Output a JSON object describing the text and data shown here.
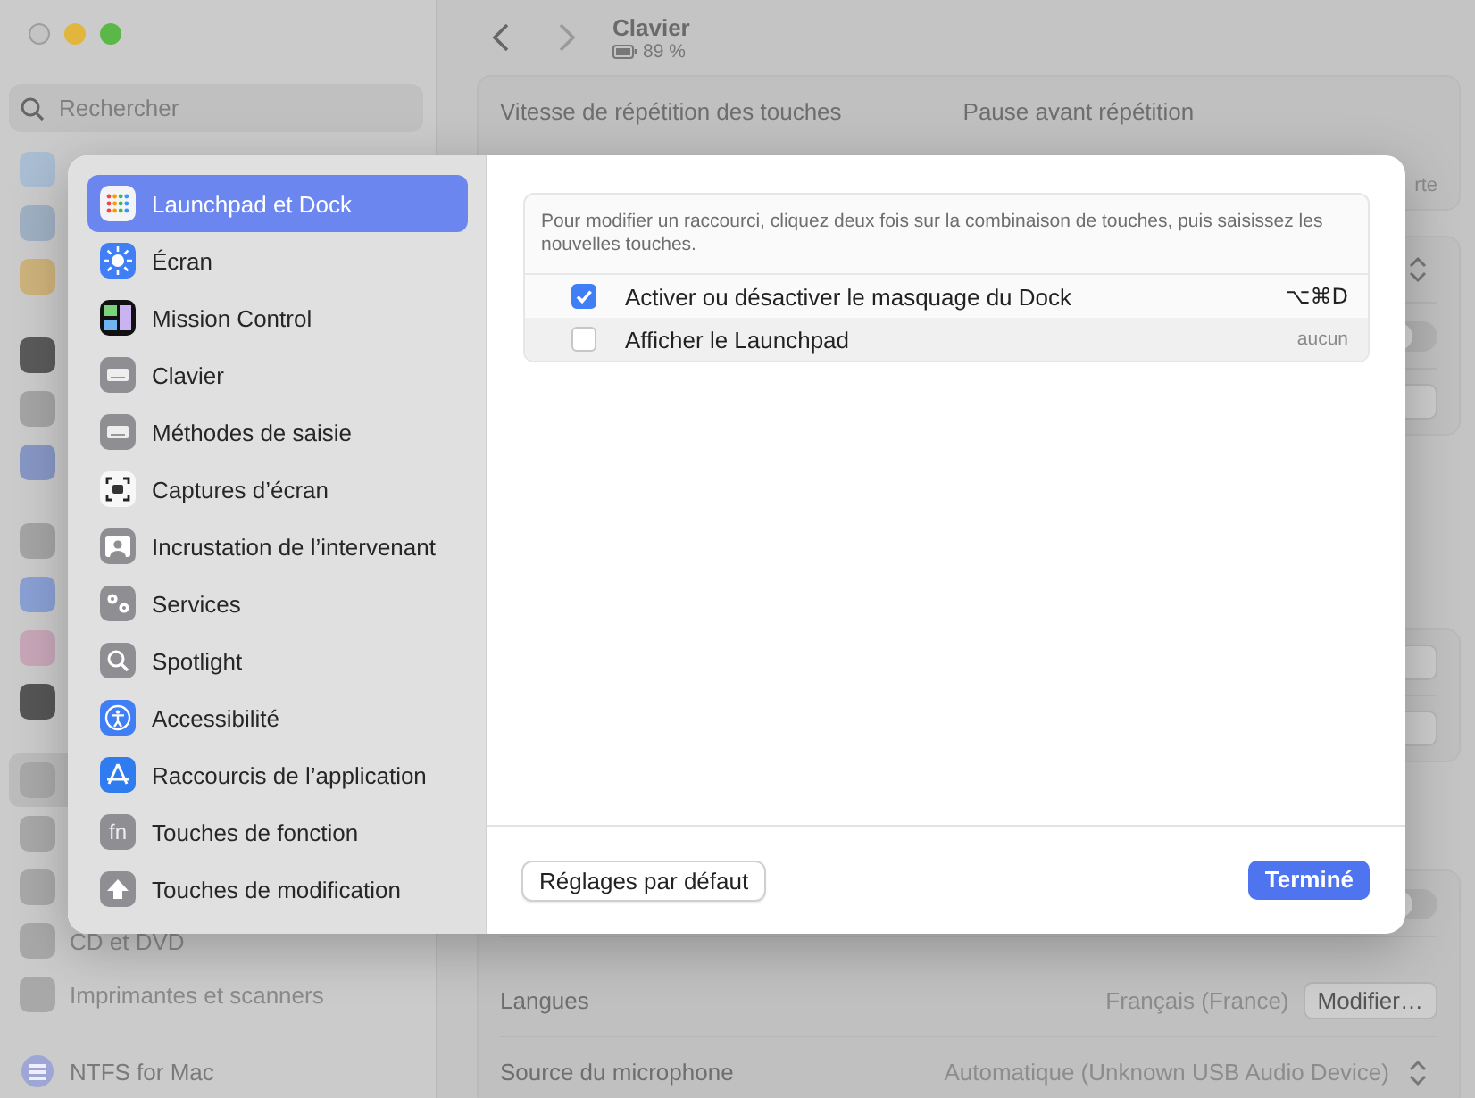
{
  "window": {
    "title": "Clavier",
    "battery": "89 %"
  },
  "sidebar": {
    "search": {
      "placeholder": "Rechercher"
    },
    "items": [
      {
        "selected": false
      },
      {
        "selected": false
      },
      {
        "selected": false
      },
      {
        "selected": false
      },
      {
        "selected": false
      },
      {
        "selected": false
      },
      {
        "selected": false
      },
      {
        "selected": false
      },
      {
        "selected": false
      },
      {
        "selected": false
      },
      {
        "selected": true
      },
      {
        "selected": false
      },
      {
        "selected": false
      },
      {
        "selected": false,
        "label": "CD et DVD"
      },
      {
        "selected": false,
        "label": "Imprimantes et scanners"
      }
    ],
    "footer": "NTFS for Mac"
  },
  "settings": {
    "repeat_labels": [
      "Vitesse de répétition des touches",
      "Pause avant répétition"
    ],
    "slider_end_label": "rte",
    "groups": [
      {
        "rows": [
          {
            "kind": "stepper"
          },
          {
            "kind": "toggle",
            "on": false
          },
          {
            "kind": "button"
          }
        ]
      },
      {
        "rows": [
          {
            "kind": "button"
          },
          {
            "kind": "button"
          }
        ]
      },
      {
        "rows": [
          {
            "kind": "toggle",
            "on": false
          },
          {
            "kind": "labeled-button",
            "label": "Langues",
            "value": "Français (France)",
            "button": "Modifier…"
          },
          {
            "kind": "labeled-stepper",
            "label": "Source du microphone",
            "value": "Automatique (Unknown USB Audio Device)"
          }
        ]
      }
    ]
  },
  "sheet": {
    "categories": [
      {
        "label": "Launchpad et Dock",
        "selected": true
      },
      {
        "label": "Écran",
        "selected": false
      },
      {
        "label": "Mission Control",
        "selected": false
      },
      {
        "label": "Clavier",
        "selected": false
      },
      {
        "label": "Méthodes de saisie",
        "selected": false
      },
      {
        "label": "Captures d’écran",
        "selected": false
      },
      {
        "label": "Incrustation de l’intervenant",
        "selected": false
      },
      {
        "label": "Services",
        "selected": false
      },
      {
        "label": "Spotlight",
        "selected": false
      },
      {
        "label": "Accessibilité",
        "selected": false
      },
      {
        "label": "Raccourcis de l’application",
        "selected": false
      },
      {
        "label": "Touches de fonction",
        "selected": false,
        "icon_text": "fn"
      },
      {
        "label": "Touches de modification",
        "selected": false
      }
    ],
    "info": "Pour modifier un raccourci, cliquez deux fois sur la combinaison de touches, puis saisissez les nouvelles touches.",
    "shortcuts": [
      {
        "label": "Activer ou désactiver le masquage du Dock",
        "checked": true,
        "keys": "⌥⌘D"
      },
      {
        "label": "Afficher le Launchpad",
        "checked": false,
        "keys": "aucun"
      }
    ],
    "buttons": [
      {
        "label": "Réglages par défaut",
        "kind": "secondary"
      },
      {
        "label": "Terminé",
        "kind": "primary"
      }
    ]
  }
}
